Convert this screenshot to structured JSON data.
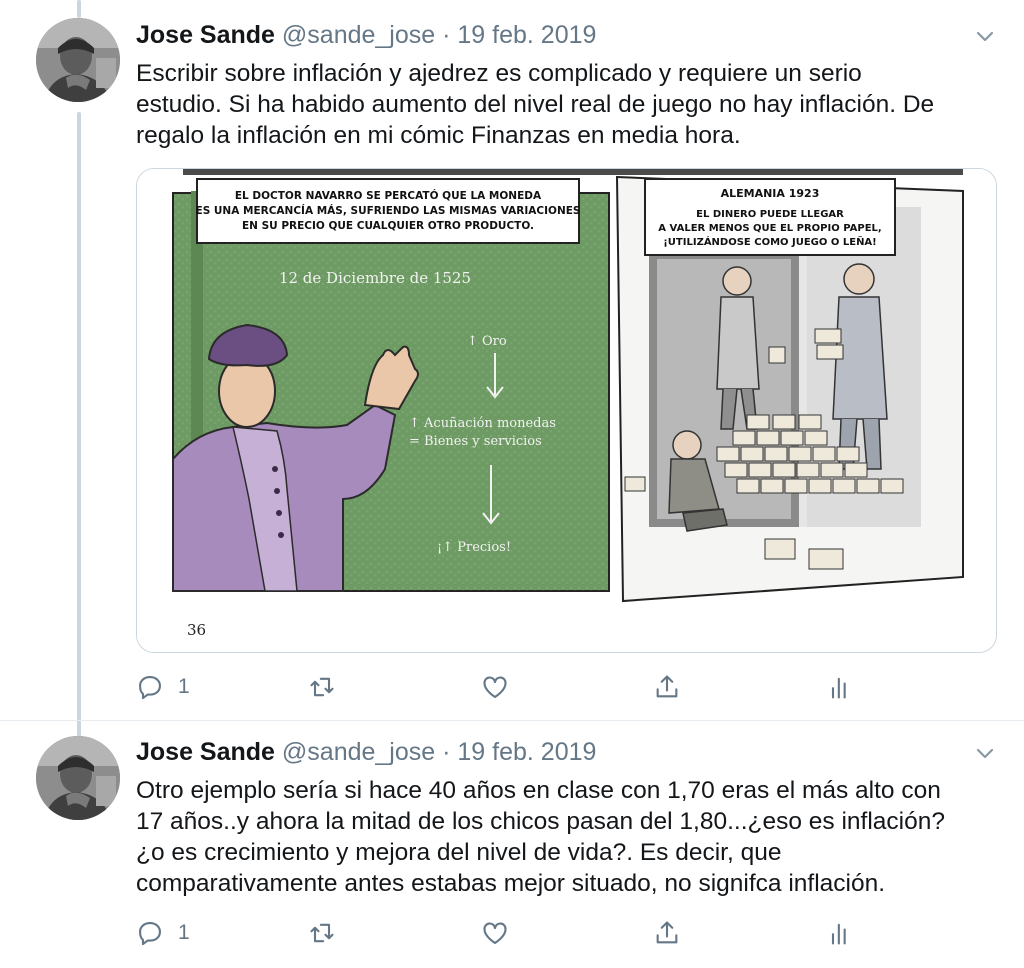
{
  "tweets": [
    {
      "author": {
        "name": "Jose Sande",
        "handle": "@sande_jose"
      },
      "separator": "·",
      "date": "19 feb. 2019",
      "text_lines": [
        "Escribir sobre inflación y ajedrez es complicado y requiere un serio",
        "estudio. Si ha habido aumento del nivel real de juego no hay inflación.  De",
        "regalo la inflación en mi cómic Finanzas en media hora."
      ],
      "media": {
        "page_number": "36",
        "panel_left": {
          "caption": [
            "EL DOCTOR NAVARRO SE PERCATÓ QUE LA MONEDA",
            "ES UNA MERCANCÍA MÁS, SUFRIENDO LAS MISMAS VARIACIONES",
            "EN SU PRECIO QUE CUALQUIER OTRO PRODUCTO."
          ],
          "date": "12 de Diciembre de 1525",
          "notes": [
            "↑ Oro",
            "↑ Acuñación monedas",
            "= Bienes y servicios",
            "¡↑ Precios!"
          ]
        },
        "panel_right": {
          "title": "ALEMANIA 1923",
          "caption": [
            "EL DINERO PUEDE LLEGAR",
            "A VALER MENOS QUE EL PROPIO PAPEL,",
            "¡UTILIZÁNDOSE COMO JUEGO O LEÑA!"
          ]
        }
      },
      "actions": {
        "reply_count": "1",
        "retweet_count": "",
        "like_count": ""
      }
    },
    {
      "author": {
        "name": "Jose Sande",
        "handle": "@sande_jose"
      },
      "separator": "·",
      "date": "19 feb. 2019",
      "text_lines": [
        "Otro ejemplo sería si hace 40 años en clase con 1,70 eras el más alto con",
        "17 años..y ahora la mitad de los chicos pasan del 1,80...¿eso es inflación?",
        "¿o es crecimiento y mejora del nivel de vida?. Es decir, que",
        "comparativamente antes estabas mejor situado, no signifca inflación."
      ],
      "actions": {
        "reply_count": "1",
        "retweet_count": "",
        "like_count": ""
      }
    }
  ],
  "icons": {
    "reply": "reply-icon",
    "retweet": "retweet-icon",
    "like": "heart-icon",
    "share": "share-icon",
    "analytics": "analytics-icon",
    "more": "chevron-down-icon"
  },
  "colors": {
    "text": "#14171a",
    "secondary": "#657786",
    "border": "#ccd6dd",
    "comic_green": "#6e9b63",
    "robe_purple": "#a78bbd"
  }
}
